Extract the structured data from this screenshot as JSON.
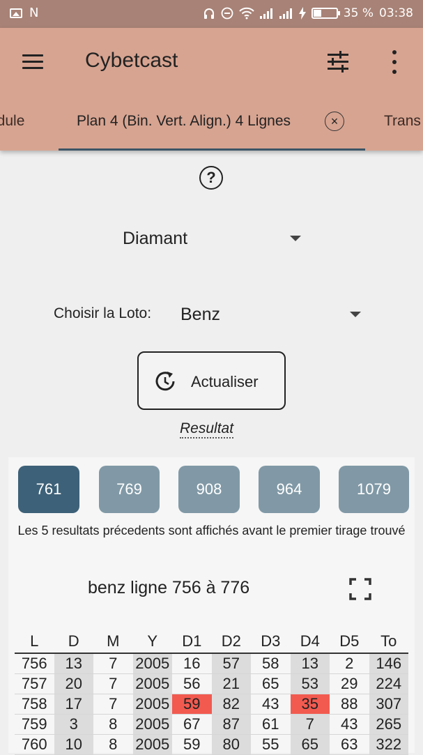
{
  "status_bar": {
    "left_letter": "N",
    "battery_percent": "35 %",
    "time": "03:38"
  },
  "app_bar": {
    "title": "Cybetcast",
    "icons": [
      "menu-icon",
      "tune-icon",
      "more-vert-icon"
    ]
  },
  "tabs": {
    "prev": "odule",
    "active": "Plan 4 (Bin. Vert. Align.) 4 Lignes",
    "close": "×",
    "next": "Trans"
  },
  "help": {
    "icon": "?"
  },
  "type_select": {
    "value": "Diamant"
  },
  "loto": {
    "label": "Choisir la Loto:",
    "value": "Benz"
  },
  "refresh_button": {
    "label": "Actualiser"
  },
  "result_link": "Resultat",
  "result_chips": [
    {
      "label": "761",
      "selected": true
    },
    {
      "label": "769",
      "selected": false
    },
    {
      "label": "908",
      "selected": false
    },
    {
      "label": "964",
      "selected": false
    },
    {
      "label": "1079",
      "selected": false
    }
  ],
  "note": "Les 5 resultats précedents sont affichés avant le premier tirage trouvé",
  "range_title": "benz ligne 756 à 776",
  "colors": {
    "chip_selected": "#3d6178",
    "chip_default": "#8199a6",
    "highlight": "#f25a50",
    "shade": "#dcdcdc"
  },
  "table": {
    "headers": [
      "L",
      "D",
      "M",
      "Y",
      "D1",
      "D2",
      "D3",
      "D4",
      "D5",
      "To"
    ],
    "rows": [
      [
        "756",
        "13",
        "7",
        "2005",
        "16",
        "57",
        "58",
        "13",
        "2",
        "146"
      ],
      [
        "757",
        "20",
        "7",
        "2005",
        "56",
        "21",
        "65",
        "53",
        "29",
        "224"
      ],
      [
        "758",
        "17",
        "7",
        "2005",
        "59",
        "82",
        "43",
        "35",
        "88",
        "307"
      ],
      [
        "759",
        "3",
        "8",
        "2005",
        "67",
        "87",
        "61",
        "7",
        "43",
        "265"
      ],
      [
        "760",
        "10",
        "8",
        "2005",
        "59",
        "80",
        "55",
        "65",
        "63",
        "322"
      ]
    ],
    "highlighted_cells": [
      [
        2,
        4
      ],
      [
        2,
        7
      ]
    ]
  }
}
